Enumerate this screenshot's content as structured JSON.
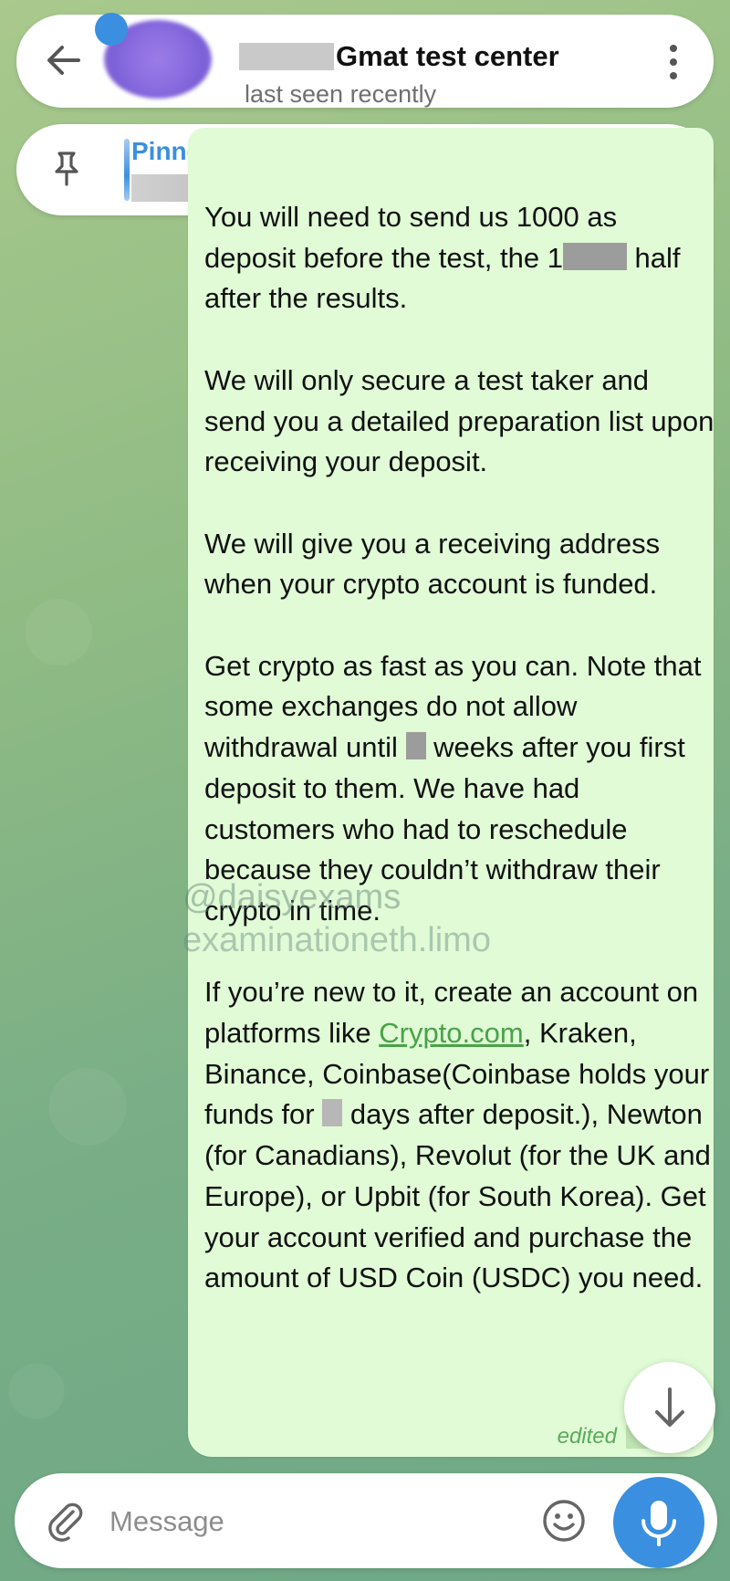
{
  "colors": {
    "accent": "#3a8fe0",
    "bubble": "#e0fbd6",
    "link": "#4aa24a",
    "edited": "#5aab5a"
  },
  "header": {
    "title": "Gmat test center",
    "status": "last seen recently",
    "back_icon": "arrow-left-icon",
    "menu_icon": "more-vertical-icon"
  },
  "pinned": {
    "title": "Pinned Message",
    "preview_ellipsis": "...",
    "pin_icon": "pin-icon",
    "close_icon": "close-icon"
  },
  "message": {
    "p1_a": "You will need to send us 1000 as deposit before the test, the 1",
    "p1_b": " half after the results.",
    "p2": "We will only secure a test taker and send you a detailed preparation list upon receiving your deposit.",
    "p3": "We will give you a receiving address when your crypto account is funded.",
    "p4_a": "Get crypto as fast as you can. Note that some exchanges do not allow withdrawal until ",
    "p4_b": " weeks after you first deposit to them. We have had customers who had to reschedule because they couldn’t withdraw their crypto in time.",
    "p5_a": "If you’re new to it, create an account on platforms like ",
    "p5_link": "Crypto.com",
    "p5_b": ", Kraken, Binance, Coinbase(Coinbase holds your funds for ",
    "p5_c": " days after deposit.), Newton (for Canadians), Revolut (for the UK and Europe), or Upbit (for South Korea). Get your account verified and purchase the amount of USD Coin (USDC) you need.",
    "edited": "edited"
  },
  "watermark": {
    "line1": "@daisyexams",
    "line2": "examinationeth.limo"
  },
  "input": {
    "placeholder": "Message",
    "attach_icon": "paperclip-icon",
    "emoji_icon": "smiley-icon",
    "mic_icon": "microphone-icon",
    "scroll_icon": "arrow-down-icon"
  }
}
